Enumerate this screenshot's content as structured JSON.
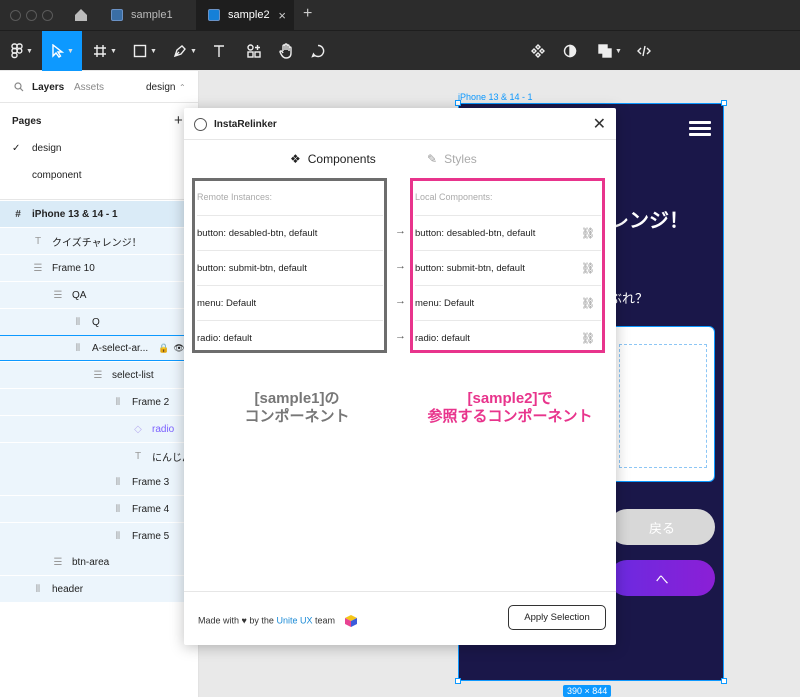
{
  "tabs": [
    {
      "label": "sample1",
      "active": false
    },
    {
      "label": "sample2",
      "active": true
    }
  ],
  "left_panel": {
    "tab_layers": "Layers",
    "tab_assets": "Assets",
    "page_dropdown": "design",
    "pages_heading": "Pages",
    "pages": [
      "design",
      "component"
    ],
    "layers": [
      "iPhone 13 & 14 - 1",
      "クイズチャレンジ！",
      "Frame 10",
      "QA",
      "Q",
      "A-select-ar...",
      "select-list",
      "Frame 2",
      "radio",
      "にんじん",
      "Frame 3",
      "Frame 4",
      "Frame 5",
      "btn-area",
      "header"
    ]
  },
  "canvas": {
    "frame_label": "iPhone 13 & 14 - 1",
    "title_fragment": "レンジ！",
    "subtitle_fragment": "ぶれ？",
    "back_button": "戻る",
    "next_button": "へ",
    "size_badge": "390 × 844"
  },
  "plugin": {
    "title": "InstaRelinker",
    "tab_components": "Components",
    "tab_styles": "Styles",
    "remote_heading": "Remote Instances:",
    "local_heading": "Local Components:",
    "remote_rows": [
      "button: desabled-btn, default",
      "button: submit-btn, default",
      "menu: Default",
      "radio: default"
    ],
    "local_rows": [
      "button: desabled-btn, default",
      "button: submit-btn, default",
      "menu: Default",
      "radio: default"
    ],
    "caption_left_1": "[sample1]の",
    "caption_left_2": "コンポーネント",
    "caption_right_1": "[sample2]で",
    "caption_right_2": "参照するコンポーネント",
    "footer_made": "Made with",
    "footer_by": "by the",
    "footer_brand": "Unite UX",
    "footer_team": "team",
    "apply_button": "Apply Selection"
  },
  "colors": {
    "accent": "#0d99ff",
    "highlight_pink": "#e8348c",
    "phone_bg": "#1a1749"
  }
}
